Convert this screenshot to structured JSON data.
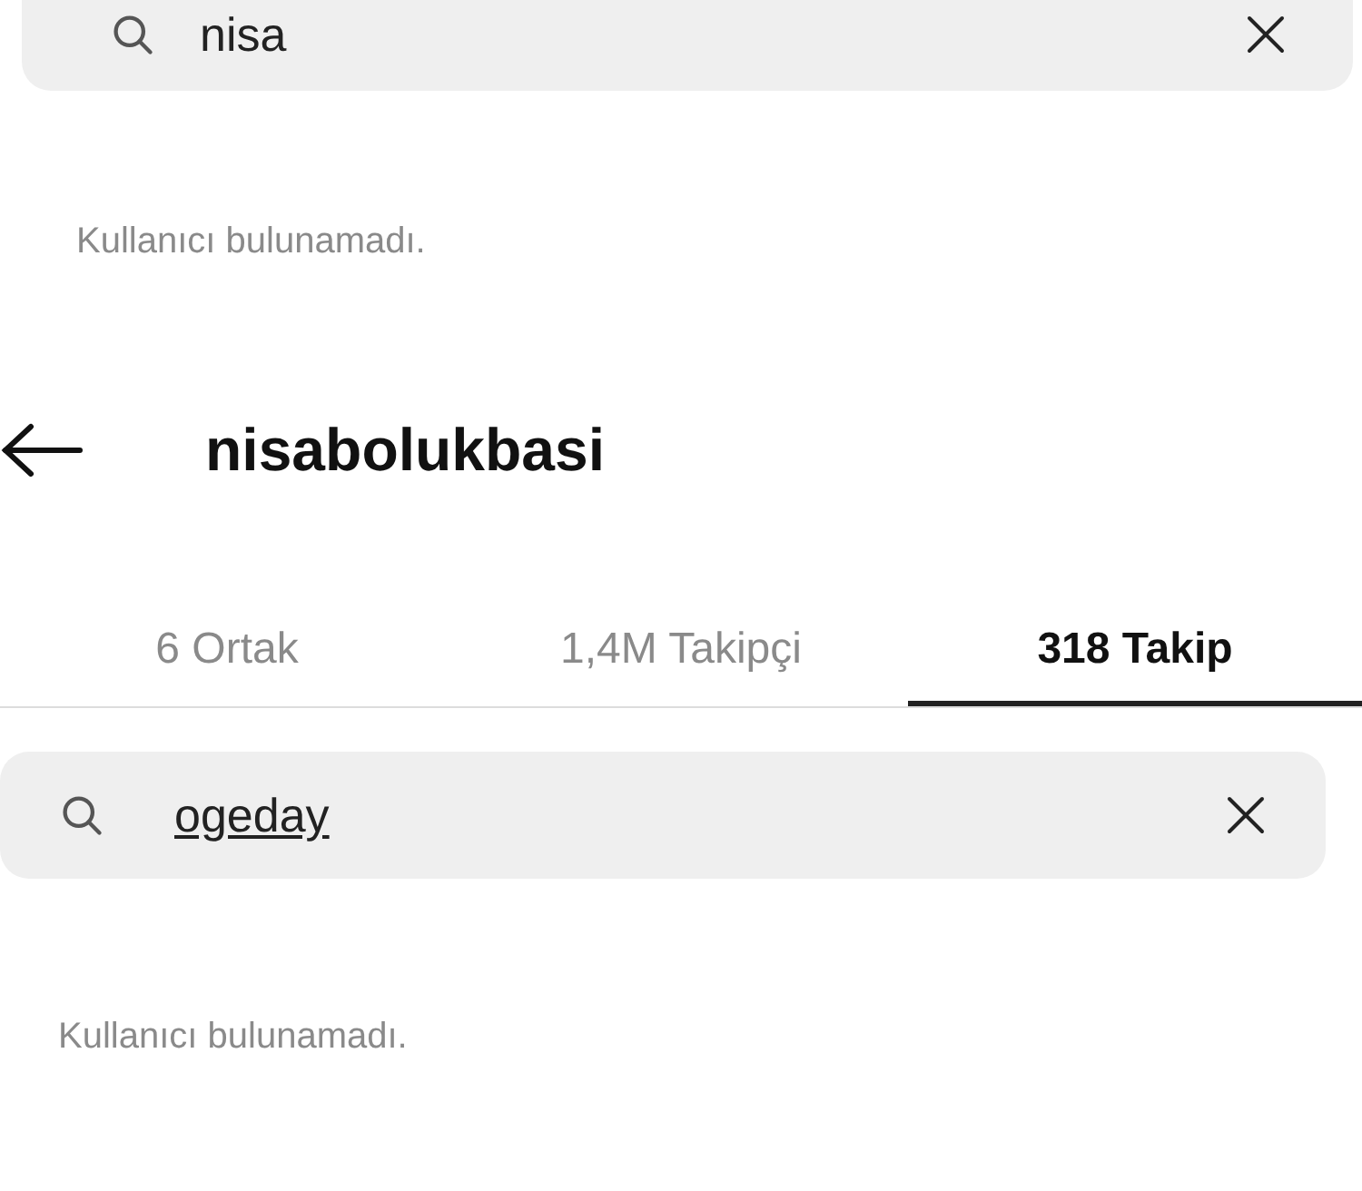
{
  "search_top": {
    "value": "nisa"
  },
  "empty_top": "Kullanıcı bulunamadı.",
  "header": {
    "title": "nisabolukbasi"
  },
  "tabs": [
    {
      "label": "6 Ortak",
      "selected": false
    },
    {
      "label": "1,4M Takipçi",
      "selected": false
    },
    {
      "label": "318 Takip",
      "selected": true
    }
  ],
  "search": {
    "value": "ogeday"
  },
  "empty": "Kullanıcı bulunamadı."
}
